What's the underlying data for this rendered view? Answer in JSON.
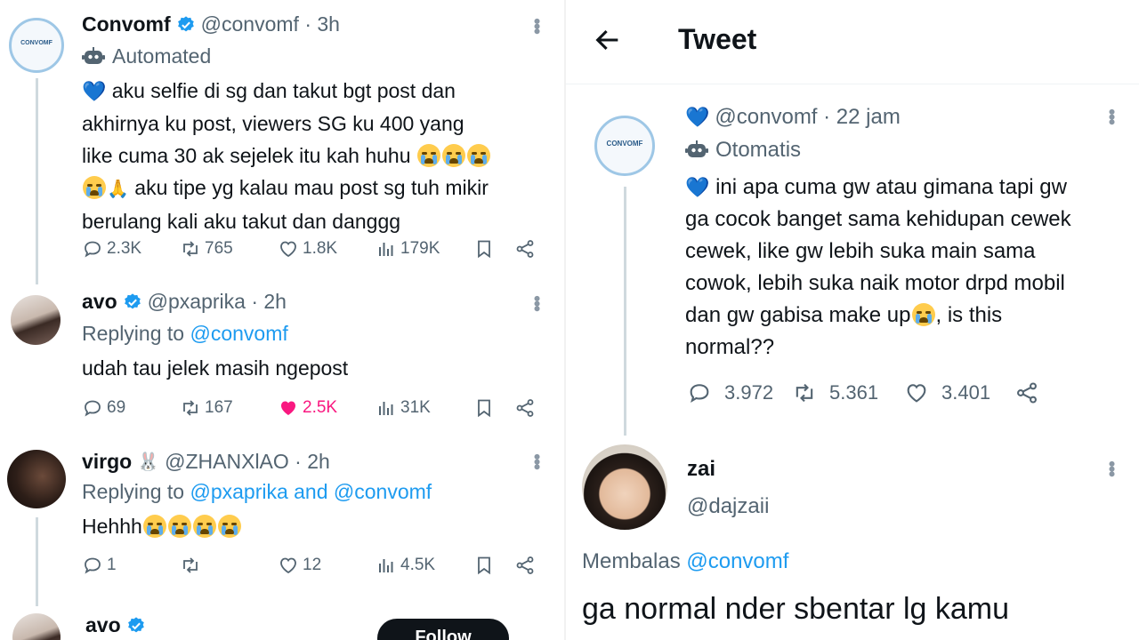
{
  "left": {
    "tweets": [
      {
        "name": "Convomf",
        "handle": "@convomf · 3h",
        "automated": "Automated",
        "avatar_text": "CONVOMF",
        "text_lines": [
          "aku selfie di sg dan takut bgt post dan",
          "akhirnya ku post, viewers SG ku 400 yang",
          "like cuma 30 ak sejelek itu kah huhu",
          "aku tipe yg kalau mau post sg tuh mikir",
          "berulang kali aku takut dan danggg"
        ],
        "replies": "2.3K",
        "retweets": "765",
        "likes": "1.8K",
        "views": "179K"
      },
      {
        "name": "avo",
        "handle": "@pxaprika · 2h",
        "replying_prefix": "Replying to ",
        "replying_to": "@convomf",
        "text": "udah tau jelek masih ngepost",
        "replies": "69",
        "retweets": "167",
        "likes": "2.5K",
        "views": "31K"
      },
      {
        "name": "virgo",
        "handle": "@ZHANXlAO · 2h",
        "replying_prefix": "Replying to ",
        "replying_to": "@pxaprika and @convomf",
        "text": "Hehhh",
        "replies": "1",
        "retweets": "",
        "likes": "12",
        "views": "4.5K"
      },
      {
        "name": "avo",
        "follow_label": "Follow"
      }
    ]
  },
  "right": {
    "header_title": "Tweet",
    "main": {
      "handle": "@convomf · 22 jam",
      "automated": "Otomatis",
      "avatar_text": "CONVOMF",
      "text_lines": [
        "ini apa cuma gw atau gimana tapi gw",
        "ga cocok banget sama kehidupan cewek",
        "cewek, like gw lebih suka main sama",
        "cowok, lebih suka naik motor drpd mobil",
        "dan gw gabisa make up",
        ", is this",
        "normal??"
      ],
      "replies": "3.972",
      "retweets": "5.361",
      "likes": "3.401"
    },
    "reply": {
      "name": "zai",
      "handle": "@dajzaii",
      "replying_prefix": "Membalas ",
      "replying_to": "@convomf",
      "text": "ga normal nder sbentar lg kamu"
    }
  },
  "colors": {
    "link": "#1d9bf0",
    "muted": "#536471",
    "liked": "#f91880",
    "verified": "#1d9bf0"
  }
}
